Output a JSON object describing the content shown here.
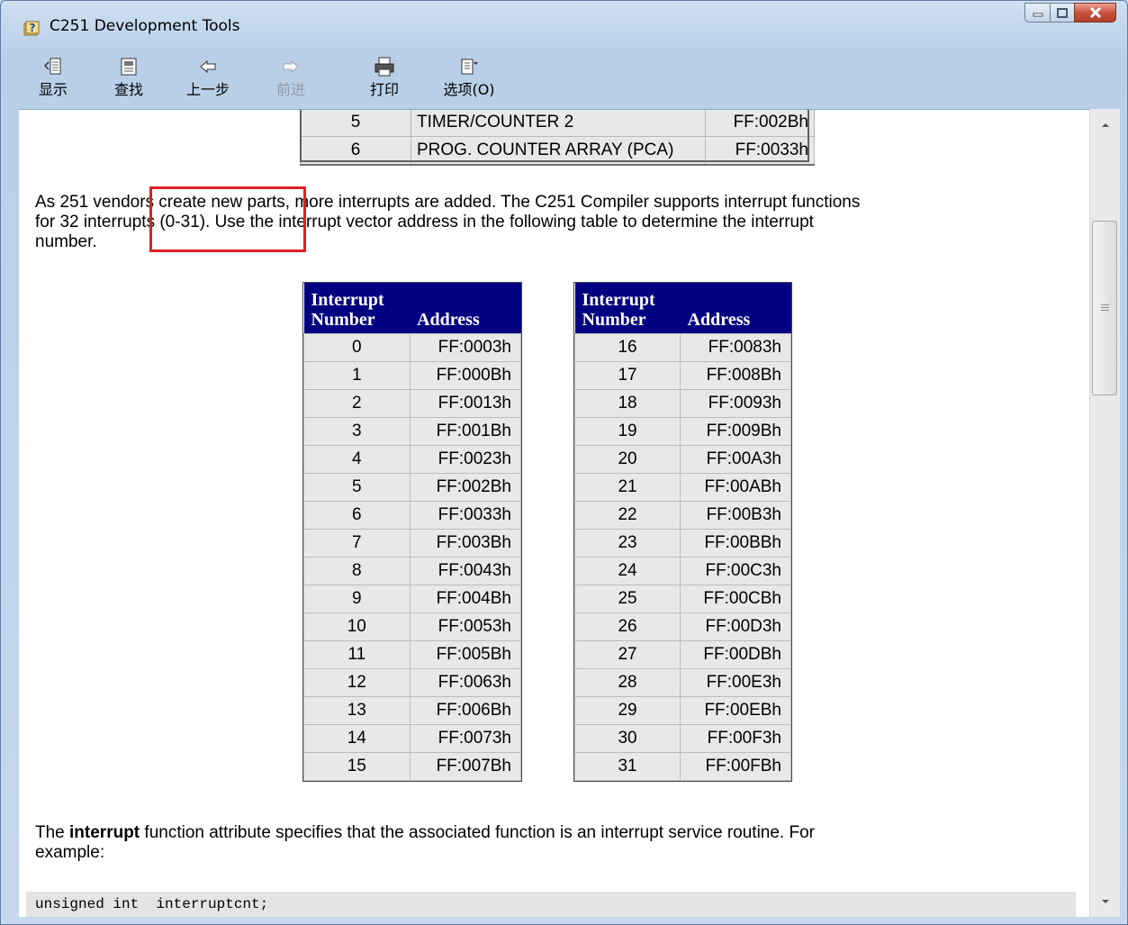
{
  "window": {
    "title": "C251 Development Tools",
    "accent_color": "#000080",
    "highlight_color": "#e02020"
  },
  "toolbar": {
    "items": [
      {
        "label": "显示",
        "icon": "show-pane-icon",
        "enabled": true
      },
      {
        "label": "查找",
        "icon": "find-icon",
        "enabled": true
      },
      {
        "label": "上一步",
        "icon": "back-arrow-icon",
        "enabled": true
      },
      {
        "label": "前进",
        "icon": "forward-arrow-icon",
        "enabled": false
      },
      {
        "label": "打印",
        "icon": "print-icon",
        "enabled": true
      },
      {
        "label": "选项(O)",
        "icon": "options-icon",
        "enabled": true
      }
    ]
  },
  "previous_table": {
    "rows": [
      {
        "num": "5",
        "name": "TIMER/COUNTER 2",
        "address": "FF:002Bh"
      },
      {
        "num": "6",
        "name": "PROG. COUNTER ARRAY (PCA)",
        "address": "FF:0033h"
      }
    ]
  },
  "paragraph1": {
    "line1": "As 251 vendors create new parts, more interrupts are added. The C251 Compiler supports interrupt functions",
    "line2": "for 32 interrupts (0-31). Use the interrupt vector address in the following table to determine the interrupt",
    "line3": "number."
  },
  "interrupt_table": {
    "header_number_line1": "Interrupt",
    "header_number_line2": "Number",
    "header_address": "Address",
    "left_rows": [
      {
        "num": "0",
        "address": "FF:0003h"
      },
      {
        "num": "1",
        "address": "FF:000Bh"
      },
      {
        "num": "2",
        "address": "FF:0013h"
      },
      {
        "num": "3",
        "address": "FF:001Bh"
      },
      {
        "num": "4",
        "address": "FF:0023h"
      },
      {
        "num": "5",
        "address": "FF:002Bh"
      },
      {
        "num": "6",
        "address": "FF:0033h"
      },
      {
        "num": "7",
        "address": "FF:003Bh"
      },
      {
        "num": "8",
        "address": "FF:0043h"
      },
      {
        "num": "9",
        "address": "FF:004Bh"
      },
      {
        "num": "10",
        "address": "FF:0053h"
      },
      {
        "num": "11",
        "address": "FF:005Bh"
      },
      {
        "num": "12",
        "address": "FF:0063h"
      },
      {
        "num": "13",
        "address": "FF:006Bh"
      },
      {
        "num": "14",
        "address": "FF:0073h"
      },
      {
        "num": "15",
        "address": "FF:007Bh"
      }
    ],
    "right_rows": [
      {
        "num": "16",
        "address": "FF:0083h"
      },
      {
        "num": "17",
        "address": "FF:008Bh"
      },
      {
        "num": "18",
        "address": "FF:0093h"
      },
      {
        "num": "19",
        "address": "FF:009Bh"
      },
      {
        "num": "20",
        "address": "FF:00A3h"
      },
      {
        "num": "21",
        "address": "FF:00ABh"
      },
      {
        "num": "22",
        "address": "FF:00B3h"
      },
      {
        "num": "23",
        "address": "FF:00BBh"
      },
      {
        "num": "24",
        "address": "FF:00C3h"
      },
      {
        "num": "25",
        "address": "FF:00CBh"
      },
      {
        "num": "26",
        "address": "FF:00D3h"
      },
      {
        "num": "27",
        "address": "FF:00DBh"
      },
      {
        "num": "28",
        "address": "FF:00E3h"
      },
      {
        "num": "29",
        "address": "FF:00EBh"
      },
      {
        "num": "30",
        "address": "FF:00F3h"
      },
      {
        "num": "31",
        "address": "FF:00FBh"
      }
    ]
  },
  "paragraph2": {
    "prefix": "The ",
    "bold": "interrupt",
    "rest_line1": " function attribute specifies that the associated function is an interrupt service routine. For",
    "line2": "example:"
  },
  "code": {
    "line1": "unsigned int  interruptcnt;"
  }
}
